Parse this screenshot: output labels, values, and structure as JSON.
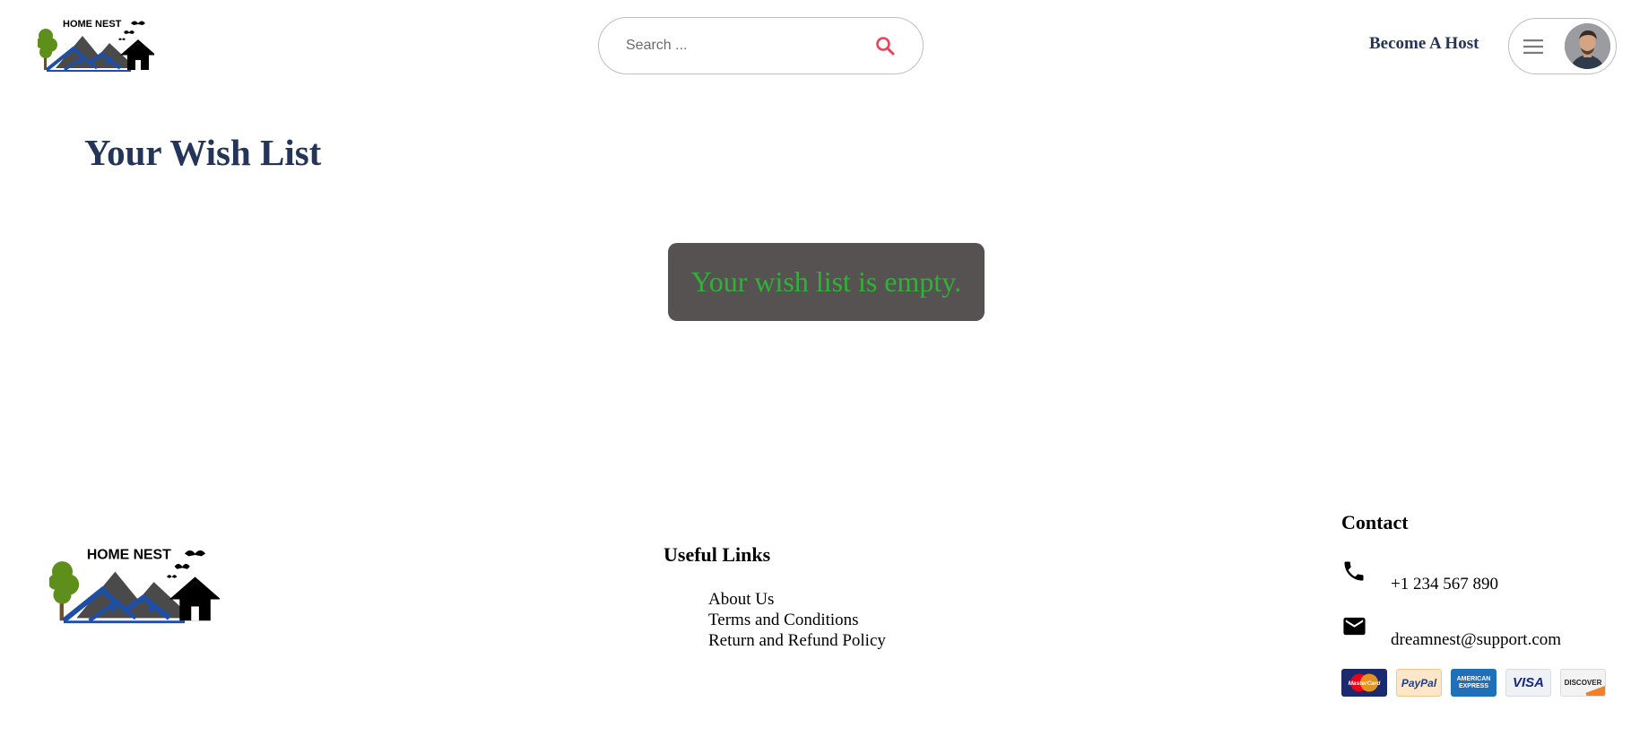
{
  "header": {
    "logo": {
      "brand_text": "HOME NEST"
    },
    "search": {
      "placeholder": "Search ..."
    },
    "become_host_label": "Become A Host"
  },
  "main": {
    "title": "Your Wish List",
    "empty_message": "Your wish list is empty."
  },
  "footer": {
    "logo": {
      "brand_text": "HOME NEST"
    },
    "useful_links": {
      "heading": "Useful Links",
      "items": [
        {
          "label": "About Us"
        },
        {
          "label": "Terms and Conditions"
        },
        {
          "label": "Return and Refund Policy"
        }
      ]
    },
    "contact": {
      "heading": "Contact",
      "phone": "+1 234 567 890",
      "email": "dreamnest@support.com",
      "phone_icon": "phone-icon",
      "email_icon": "mail-icon"
    },
    "payments": [
      {
        "name": "mastercard",
        "text": "MasterCard"
      },
      {
        "name": "paypal",
        "text": "PayPal"
      },
      {
        "name": "amex",
        "text": "AMERICAN EXPRESS"
      },
      {
        "name": "visa",
        "text": "VISA"
      },
      {
        "name": "discover",
        "text": "DISCOVER"
      }
    ]
  },
  "colors": {
    "title": "#24355a",
    "accent_search": "#e8455b",
    "empty_box_bg": "#575252",
    "empty_text": "#2db336"
  }
}
